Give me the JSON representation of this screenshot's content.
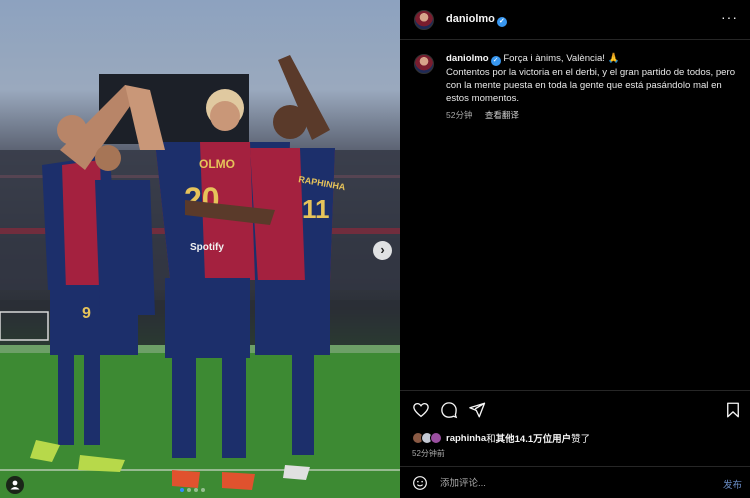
{
  "post": {
    "username": "daniolmo",
    "caption_first_line": "Força i ànims, València! 🙏",
    "caption_rest": "Contentos por la victoria en el derbi, y el gran partido de todos, pero con la mente puesta en toda la gente que está pasándolo mal en estos momentos.",
    "caption_time": "52分钟",
    "translate_label": "查看翻译",
    "more_label": "···",
    "likes_user": "raphinha",
    "likes_mid": "和",
    "likes_others": "其他14.1万位用户",
    "likes_suffix": "赞了",
    "post_time": "52分钟前",
    "comment_placeholder": "添加评论...",
    "post_button": "发布"
  },
  "photo": {
    "jersey_left": "OLMO",
    "jersey_left_number": "20",
    "jersey_right": "RAPHINHA",
    "jersey_right_number": "11",
    "shorts_number": "9",
    "sponsor": "Spotify",
    "next_arrow": "›",
    "carousel_count": 4
  },
  "icons": {
    "verified": "verified-badge-icon",
    "like": "heart-icon",
    "comment": "comment-bubble-icon",
    "share": "paper-plane-icon",
    "save": "bookmark-icon",
    "emoji": "smiley-icon",
    "tag": "person-tag-icon"
  },
  "colors": {
    "accent": "#3897f0",
    "barca_blue": "#1c2f6b",
    "barca_red": "#a4213f",
    "background": "#000000"
  }
}
